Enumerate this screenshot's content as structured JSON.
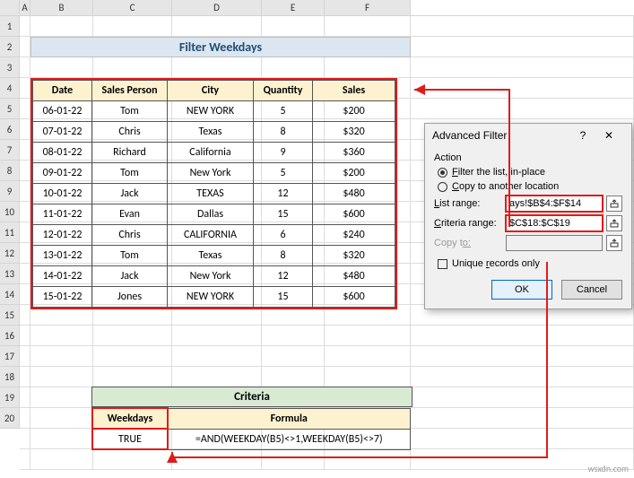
{
  "columns": [
    "A",
    "B",
    "C",
    "D",
    "E",
    "F"
  ],
  "rows_shown": 20,
  "title": "Filter Weekdays",
  "table": {
    "headers": [
      "Date",
      "Sales Person",
      "City",
      "Quantity",
      "Sales"
    ],
    "rows": [
      [
        "06-01-22",
        "Tom",
        "NEW YORK",
        "5",
        "$200"
      ],
      [
        "07-01-22",
        "Chris",
        "Texas",
        "8",
        "$320"
      ],
      [
        "08-01-22",
        "Richard",
        "California",
        "9",
        "$360"
      ],
      [
        "09-01-22",
        "Tom",
        "New York",
        "5",
        "$200"
      ],
      [
        "10-01-22",
        "Jack",
        "TEXAS",
        "12",
        "$480"
      ],
      [
        "11-01-22",
        "Evan",
        "Dallas",
        "15",
        "$600"
      ],
      [
        "12-01-22",
        "Chris",
        "CALIFORNIA",
        "6",
        "$240"
      ],
      [
        "13-01-22",
        "Tom",
        "Texas",
        "8",
        "$320"
      ],
      [
        "14-01-22",
        "Jack",
        "New York",
        "12",
        "$480"
      ],
      [
        "15-01-22",
        "Jones",
        "NEW YORK",
        "15",
        "$600"
      ]
    ]
  },
  "criteria": {
    "title": "Criteria",
    "headers": [
      "Weekdays",
      "Formula"
    ],
    "row": [
      "TRUE",
      "=AND(WEEKDAY(B5)<>1,WEEKDAY(B5)<>7)"
    ]
  },
  "dialog": {
    "title": "Advanced Filter",
    "help": "?",
    "close": "✕",
    "action_label": "Action",
    "opt_inplace_pre": "F",
    "opt_inplace_rest": "ilter the list, in-place",
    "opt_copy_pre": "C",
    "opt_copy_rest": "opy to another location",
    "list_label_pre": "L",
    "list_label_rest": "ist range:",
    "criteria_label_pre": "C",
    "criteria_label_rest": "riteria range:",
    "copyto_label_pre": "Copy t",
    "copyto_label_rest": "o:",
    "list_value": "ays!$B$4:$F$14",
    "criteria_value": "$C$18:$C$19",
    "copyto_value": "",
    "unique_pre": "Unique ",
    "unique_key": "r",
    "unique_rest": "ecords only",
    "ok": "OK",
    "cancel": "Cancel"
  },
  "watermark": "wsxdn.com"
}
